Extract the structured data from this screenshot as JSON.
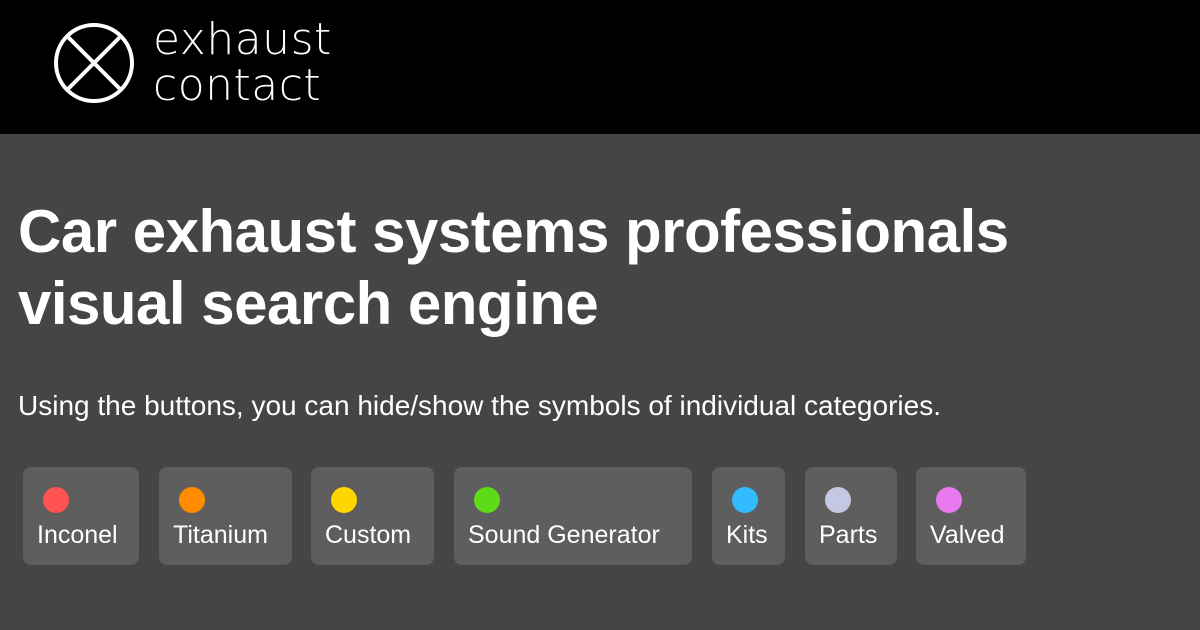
{
  "header": {
    "logo": {
      "line1": "exhaust",
      "line2": "contact",
      "icon": "circled-x-icon"
    }
  },
  "main": {
    "title": "Car exhaust systems professionals visual search engine",
    "intro": "Using the buttons, you can hide/show the symbols of individual categories."
  },
  "filters": [
    {
      "label": "Inconel",
      "color": "#ff5252"
    },
    {
      "label": "Titanium",
      "color": "#ff8c00"
    },
    {
      "label": "Custom",
      "color": "#ffd500"
    },
    {
      "label": "Sound Generator",
      "color": "#5cdb16"
    },
    {
      "label": "Kits",
      "color": "#33bbff"
    },
    {
      "label": "Parts",
      "color": "#c4c8e4"
    },
    {
      "label": "Valved",
      "color": "#e879f0"
    }
  ]
}
